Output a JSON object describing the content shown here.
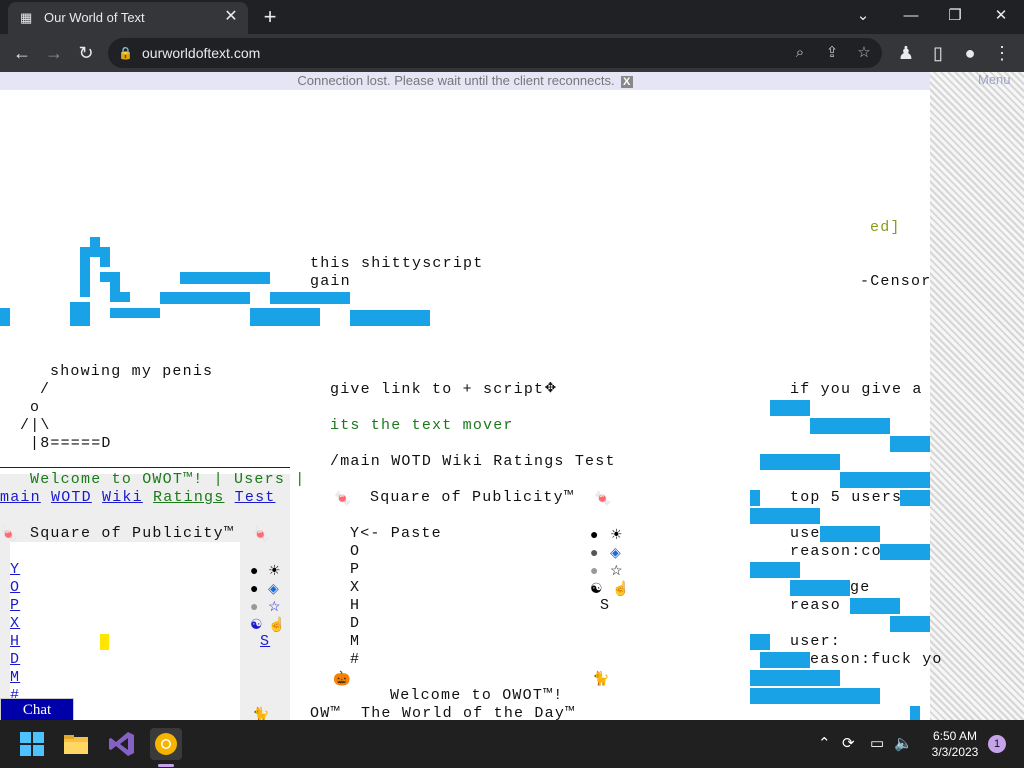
{
  "browser": {
    "tab_title": "Our World of Text",
    "url": "ourworldoftext.com",
    "new_tab": "+",
    "tab_close": "✕"
  },
  "page": {
    "notice": "Connection lost. Please wait until the client reconnects.",
    "notice_close": "X",
    "menu_label": "Menu",
    "chat_label": "Chat",
    "texts": {
      "ed": "ed]",
      "script1": "this shittyscript",
      "script2": "gain",
      "censor": "-Censor",
      "showing": "showing my penis",
      "slash": "/",
      "o": "o",
      "body": "/|\\",
      "eight": "|8=====D",
      "give_link": "give link to + script",
      "if_you_give": "if you give a",
      "text_mover": "its the text mover",
      "main_line": "/main WOTD Wiki Ratings Test",
      "top5": "top 5 users",
      "use": "use",
      "reason_co": "reason:co",
      "ge": "ge",
      "reaso": "reaso",
      "user": "user:",
      "reason_fuck": "eason:fuck yo",
      "welcome_bar": "Welcome to OWOT™! | Users |",
      "link_main": "main",
      "link_wotd": "WOTD",
      "link_wiki": "Wiki",
      "link_ratings": "Ratings",
      "link_test": "Test",
      "sq_left": "Square of Publicity™",
      "sq_center": "Square of Publicity™",
      "paste": "Y<- Paste",
      "col_o": "O",
      "col_p": "P",
      "col_x": "X",
      "col_h": "H",
      "col_d": "D",
      "col_m": "M",
      "col_hash": "#",
      "s_center": "S",
      "s_left": "S",
      "welcome_center": "Welcome to OWOT™!",
      "ow_wotd": "OW™  The World of the Day™",
      "left_letters": [
        "Y",
        "O",
        "P",
        "X",
        "H",
        "D",
        "M",
        "#"
      ]
    }
  },
  "taskbar": {
    "time": "6:50 AM",
    "date": "3/3/2023",
    "notifications": "1"
  }
}
